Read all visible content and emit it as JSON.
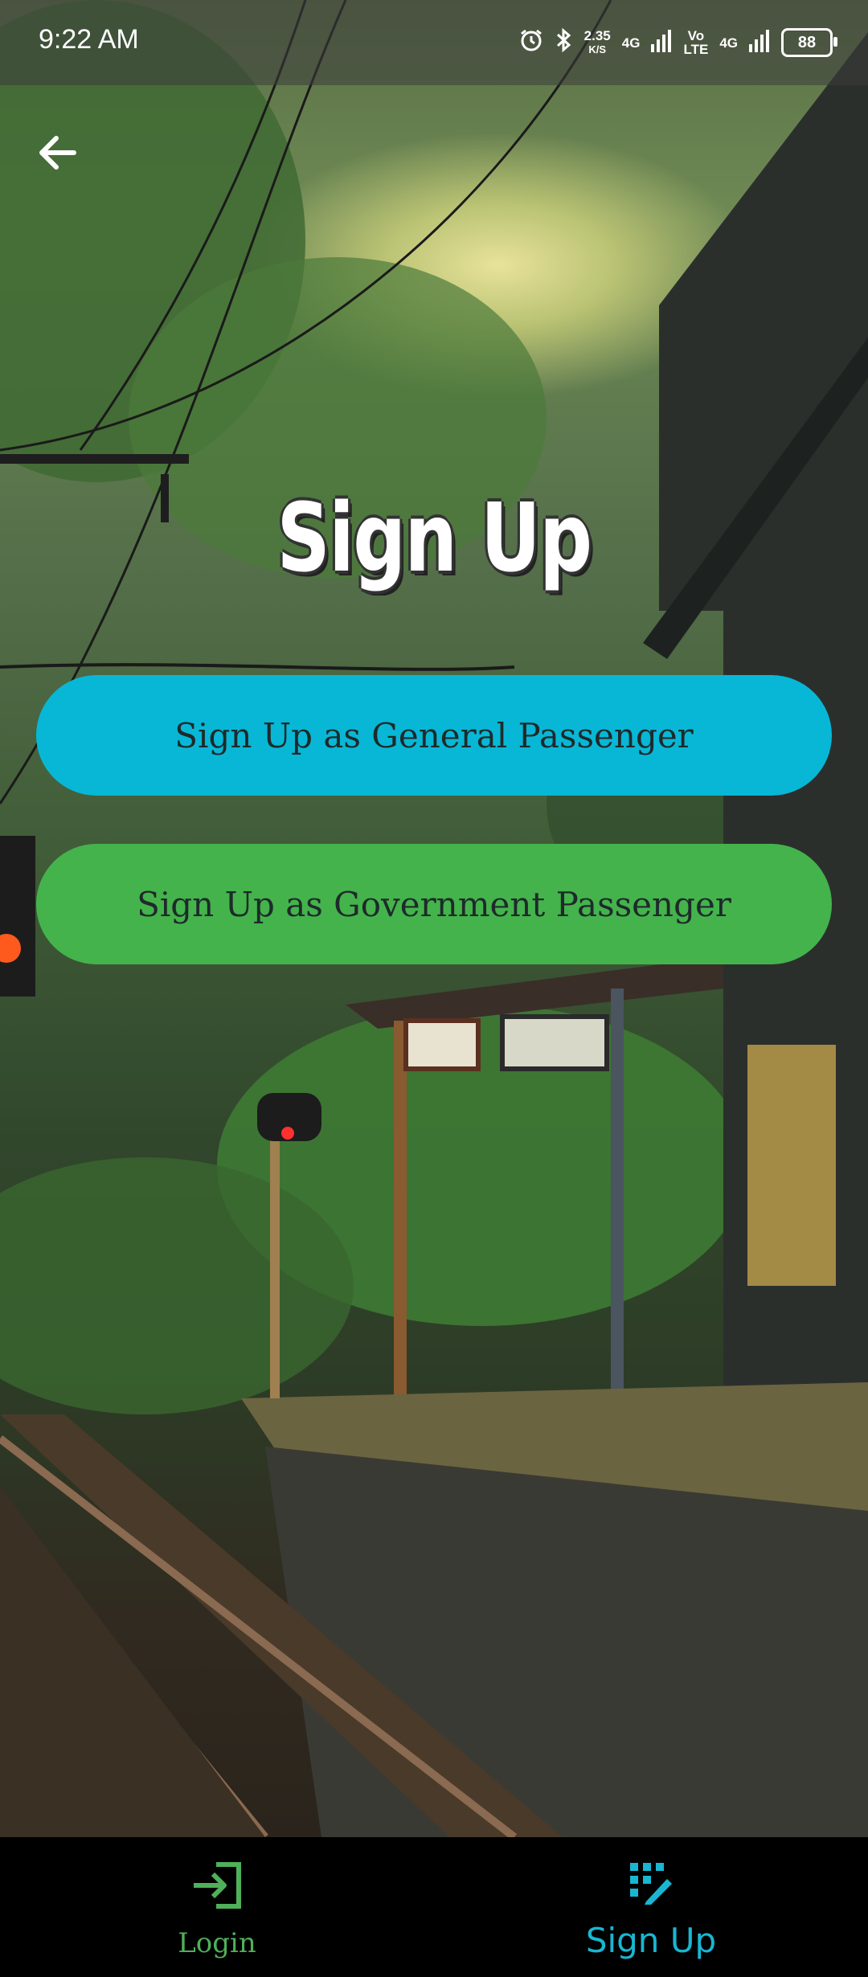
{
  "status_bar": {
    "time": "9:22 AM",
    "speed_value": "2.35",
    "speed_unit": "K/S",
    "network_1": "4G",
    "volte_top": "Vo",
    "volte_bottom": "LTE",
    "network_2": "4G",
    "battery": "88",
    "icons": [
      "alarm-icon",
      "bluetooth-icon",
      "signal-icon",
      "signal-icon",
      "battery-icon"
    ]
  },
  "header": {
    "back_icon": "arrow-left-icon",
    "title": "Sign Up"
  },
  "actions": {
    "general_label": "Sign Up as General Passenger",
    "government_label": "Sign Up as Government Passenger"
  },
  "bottom_nav": {
    "items": [
      {
        "label": "Login",
        "icon": "login-icon",
        "active": false
      },
      {
        "label": "Sign Up",
        "icon": "signup-icon",
        "active": true
      }
    ]
  },
  "colors": {
    "general_button": "#08b7d6",
    "government_button": "#44b34c",
    "nav_active": "#19b6d2",
    "nav_inactive": "#4fb05a",
    "nav_background": "#000000"
  }
}
